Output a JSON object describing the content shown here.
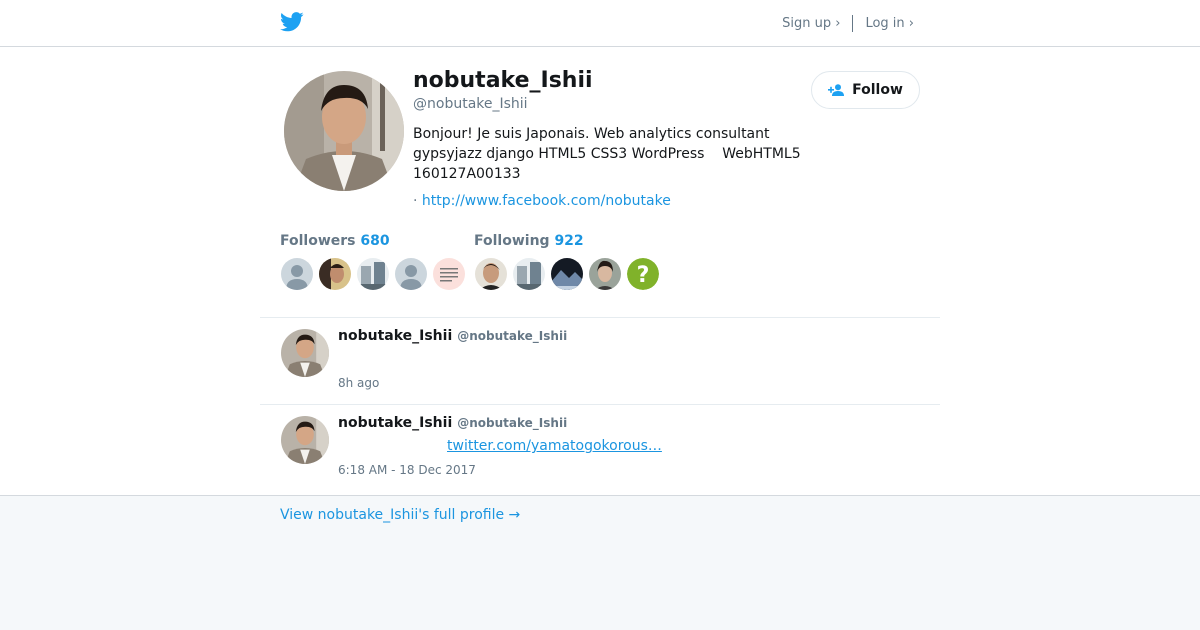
{
  "header": {
    "logo_icon": "twitter-bird-icon",
    "brand_color": "#1da1f2",
    "sign_up_label": "Sign up ›",
    "log_in_label": "Log in ›"
  },
  "profile": {
    "display_name": "nobutake_Ishii",
    "screen_name": "@nobutake_Ishii",
    "bio": "Bonjour! Je suis Japonais. Web analytics consultant\ngypsyjazz django HTML5 CSS3 WordPress    WebHTML5\n160127A00133",
    "url_prefix": "·",
    "url": "http://www.facebook.com/nobutake",
    "follow_label": "Follow",
    "follow_icon": "add-user-icon"
  },
  "stats": {
    "followers_label": "Followers",
    "followers_count": "680",
    "following_label": "Following",
    "following_count": "922",
    "link_color": "#1b95e0"
  },
  "tweets": [
    {
      "name": "nobutake_Ishii",
      "handle": "@nobutake_Ishii",
      "time": "8h ago"
    },
    {
      "name": "nobutake_Ishii",
      "handle": "@nobutake_Ishii",
      "link": "twitter.com/yamatogokorous…",
      "time": "6:18 AM - 18 Dec 2017"
    }
  ],
  "footer": {
    "full_profile_label": "View nobutake_Ishii's full profile →"
  }
}
